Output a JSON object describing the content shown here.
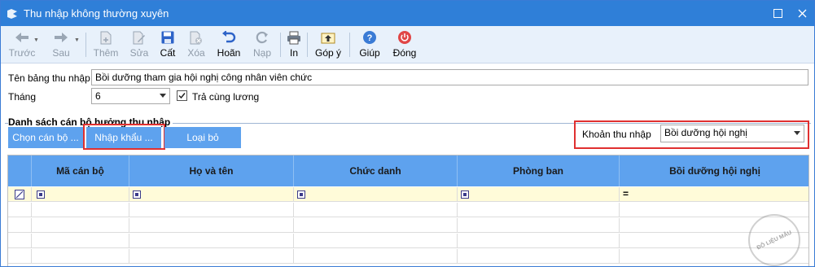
{
  "window": {
    "title": "Thu nhập không thường xuyên"
  },
  "toolbar": {
    "back": "Trước",
    "forward": "Sau",
    "add": "Thêm",
    "edit": "Sửa",
    "save": "Cất",
    "delete": "Xóa",
    "undo": "Hoãn",
    "reload": "Nạp",
    "print": "In",
    "feedback": "Góp ý",
    "help": "Giúp",
    "close": "Đóng"
  },
  "form": {
    "name_label": "Tên bảng thu nhập",
    "name_value": "Bồi dưỡng tham gia hội nghị công nhân viên chức",
    "month_label": "Tháng",
    "month_value": "6",
    "pay_with_salary_label": "Trả cùng lương",
    "pay_with_salary_checked": true
  },
  "section": {
    "title": "Danh sách cán bộ hưởng thu nhập",
    "choose_button": "Chọn cán bộ ...",
    "import_button": "Nhập khẩu ...",
    "remove_button": "Loại bỏ",
    "income_label": "Khoản thu nhập",
    "income_value": "Bồi dưỡng hội nghị"
  },
  "grid": {
    "columns": [
      "Mã cán bộ",
      "Họ và tên",
      "Chức danh",
      "Phòng ban",
      "Bồi dưỡng hội nghị"
    ],
    "filter_eq": "="
  },
  "watermark": "ĐỖ LIỆU MẪU",
  "colors": {
    "titlebar": "#2f7fd8",
    "accent": "#5ea2ee",
    "highlight": "#e03030"
  }
}
